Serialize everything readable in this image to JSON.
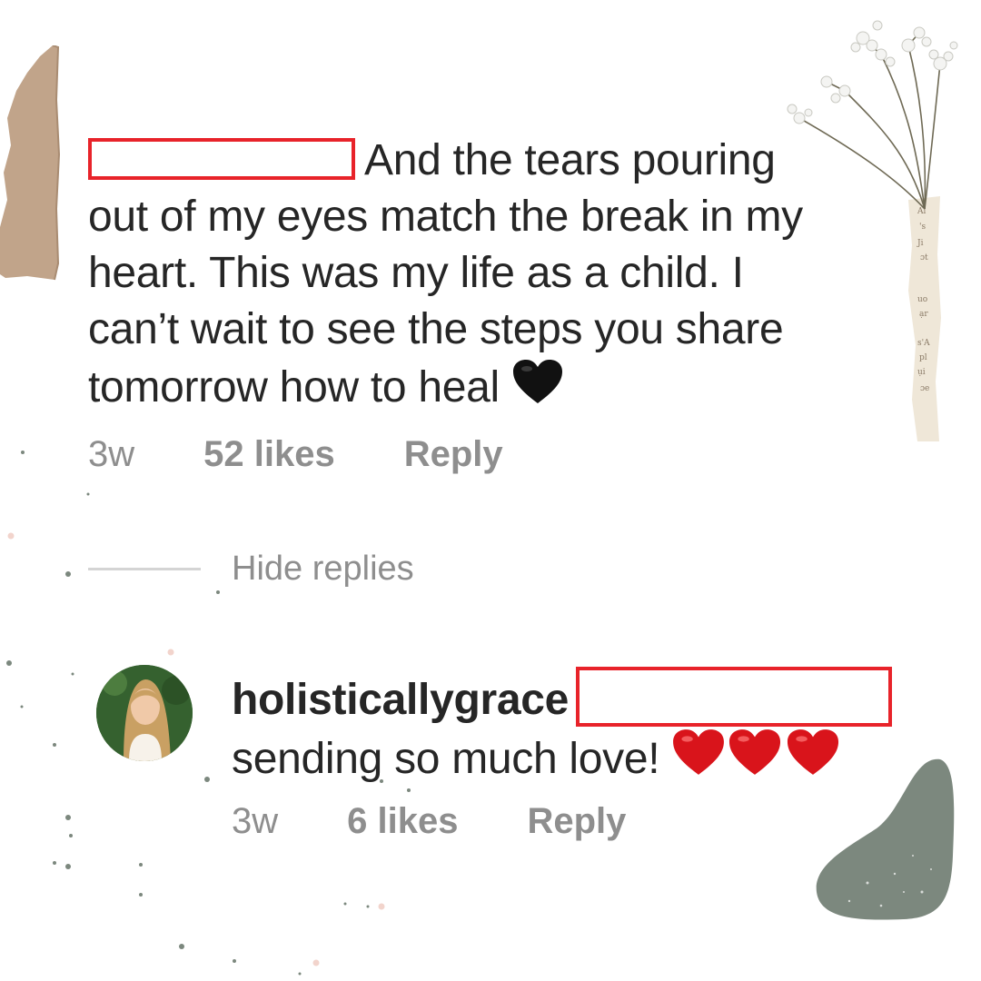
{
  "comment": {
    "text": "And the tears pouring\nout of my eyes match the break in my\nheart. This was my life as a child. I\ncan’t wait to see the steps you share\ntomorrow how to heal",
    "time": "3w",
    "likes": "52 likes",
    "reply_label": "Reply"
  },
  "hide_replies_label": "Hide replies",
  "reply": {
    "username": "holisticallygrace",
    "text": "sending so much love!",
    "time": "3w",
    "likes": "6 likes",
    "reply_label": "Reply"
  },
  "colors": {
    "redaction_border": "#e8232a",
    "meta_text": "#8e8e8e",
    "body_text": "#262626",
    "heart_red": "#d9141b",
    "heart_black": "#111111",
    "sage_blob": "#7c887e",
    "kraft_paper": "#c1a48a"
  },
  "icons": {
    "comment_end": "black-heart-icon",
    "reply_end": [
      "red-heart-icon",
      "red-heart-icon",
      "red-heart-icon"
    ]
  }
}
